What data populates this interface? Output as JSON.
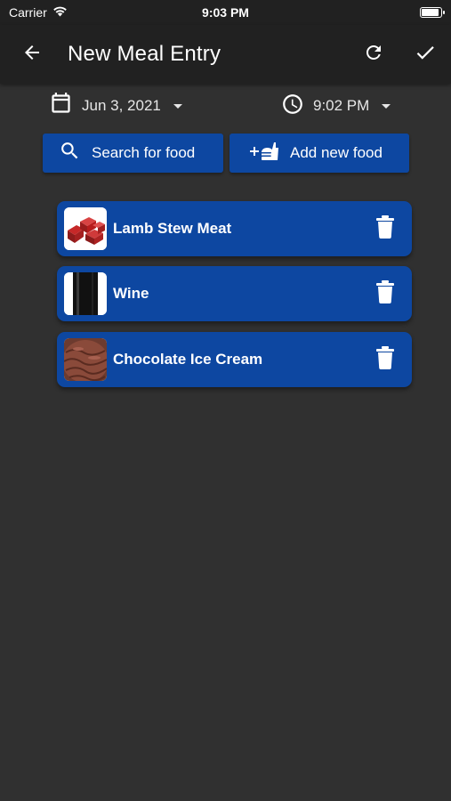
{
  "status_bar": {
    "carrier": "Carrier",
    "time": "9:03 PM"
  },
  "app_bar": {
    "title": "New Meal Entry",
    "back_icon": "arrow-back-icon",
    "refresh_icon": "refresh-icon",
    "save_icon": "check-icon"
  },
  "date_picker": {
    "value": "Jun 3, 2021",
    "icon": "calendar-icon"
  },
  "time_picker": {
    "value": "9:02 PM",
    "icon": "clock-icon"
  },
  "actions": {
    "search_label": "Search for food",
    "add_label": "Add new food"
  },
  "food_items": [
    {
      "name": "Lamb Stew Meat",
      "thumb": "raw-meat-cubes"
    },
    {
      "name": "Wine",
      "thumb": "wine-bottle"
    },
    {
      "name": "Chocolate Ice Cream",
      "thumb": "ice-cream-scoop"
    }
  ],
  "colors": {
    "background": "#303030",
    "app_bar": "#212121",
    "accent": "#0d47a1"
  }
}
